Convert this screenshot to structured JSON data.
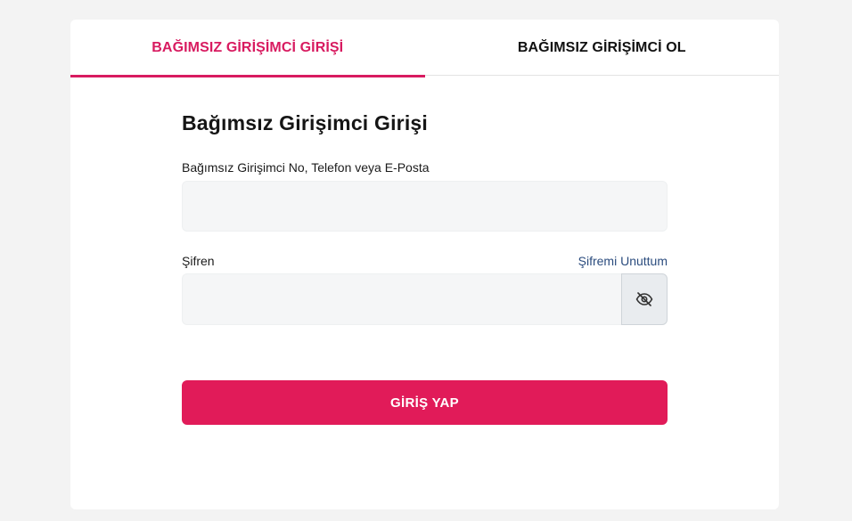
{
  "tabs": {
    "login_label": "BAĞIMSIZ GİRİŞİMCİ GİRİŞİ",
    "signup_label": "BAĞIMSIZ GİRİŞİMCİ OL"
  },
  "form": {
    "title": "Bağımsız Girişimci Girişi",
    "id_label": "Bağımsız Girişimci No, Telefon veya E-Posta",
    "id_value": "",
    "id_placeholder": "",
    "password_label": "Şifren",
    "password_value": "",
    "password_placeholder": "",
    "forgot_link": "Şifremi Unuttum",
    "submit_label": "GİRİŞ YAP"
  },
  "icons": {
    "password_toggle": "eye-slash-icon"
  },
  "colors": {
    "accent": "#e11b59",
    "active_tab": "#d81b60",
    "link": "#2b4c7e",
    "input_bg": "#f5f6f7",
    "page_bg": "#f3f3f3"
  }
}
